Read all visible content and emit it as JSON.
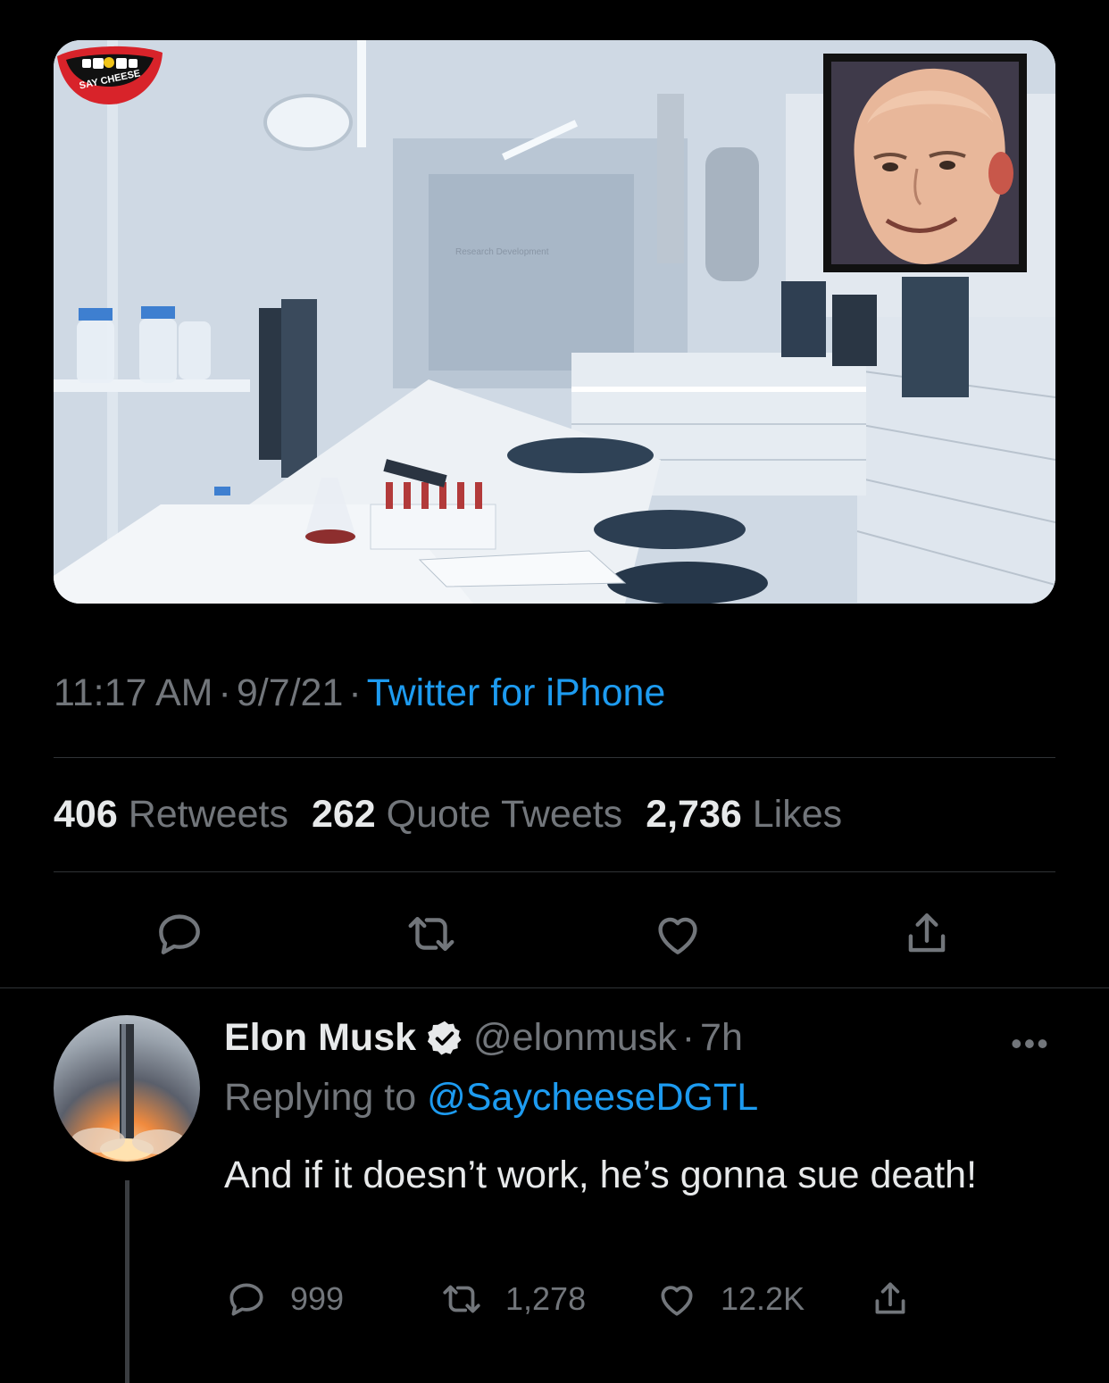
{
  "tweet": {
    "time": "11:17 AM",
    "date": "9/7/21",
    "source": "Twitter for iPhone",
    "separator": "·",
    "stats": {
      "retweets_count": "406",
      "retweets_label": "Retweets",
      "quotes_count": "262",
      "quotes_label": "Quote Tweets",
      "likes_count": "2,736",
      "likes_label": "Likes"
    },
    "media": {
      "logo_text": "SAY CHEESE",
      "sign_text": "Research Development"
    },
    "actions": [
      "reply-icon",
      "retweet-icon",
      "like-icon",
      "share-icon"
    ]
  },
  "reply": {
    "name": "Elon Musk",
    "handle": "@elonmusk",
    "time": "7h",
    "replying_label": "Replying to",
    "replying_to": "@SaycheeseDGTL",
    "text": "And if it doesn’t work, he’s gonna sue death!",
    "more": "•••",
    "counts": {
      "replies": "999",
      "retweets": "1,278",
      "likes": "12.2K"
    }
  },
  "colors": {
    "background": "#000000",
    "text": "#e7e9ea",
    "muted": "#72767b",
    "link": "#1d9bf0",
    "divider": "#2f3336"
  }
}
